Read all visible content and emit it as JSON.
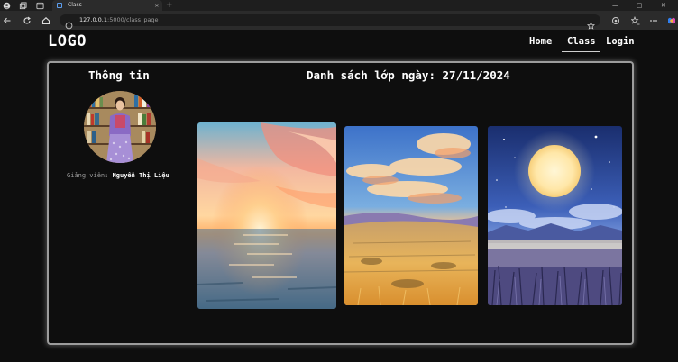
{
  "browser": {
    "tab_title": "Class",
    "tab_close": "✕",
    "new_tab": "+",
    "url_host": "127.0.0.1",
    "url_path": ":5000/class_page",
    "win_min": "—",
    "win_max": "▢",
    "win_close": "✕",
    "icons": [
      "profile-icon",
      "collections-icon",
      "tab-actions-icon",
      "back-icon",
      "refresh-icon",
      "home-icon",
      "info-icon",
      "star-icon",
      "extensions-icon",
      "favorites-icon",
      "more-icon",
      "copilot-icon"
    ]
  },
  "header": {
    "logo": "LOGO",
    "nav": [
      "Home",
      "Class",
      "Login"
    ],
    "active_nav": "Class"
  },
  "sidebar": {
    "title": "Thông tin",
    "teacher_label": "Giảng viên:",
    "teacher_name": "Nguyễn Thị Liệu"
  },
  "main": {
    "title": "Danh sách lớp ngày: 27/11/2024",
    "images": [
      "sunset-ocean-painting",
      "sunset-meadow-painting",
      "moonlit-field-painting"
    ]
  },
  "colors": {
    "page_bg": "#0e0e0e",
    "card_border": "#9c9c9c",
    "text": "#ffffff",
    "muted": "#9a9a9a"
  }
}
